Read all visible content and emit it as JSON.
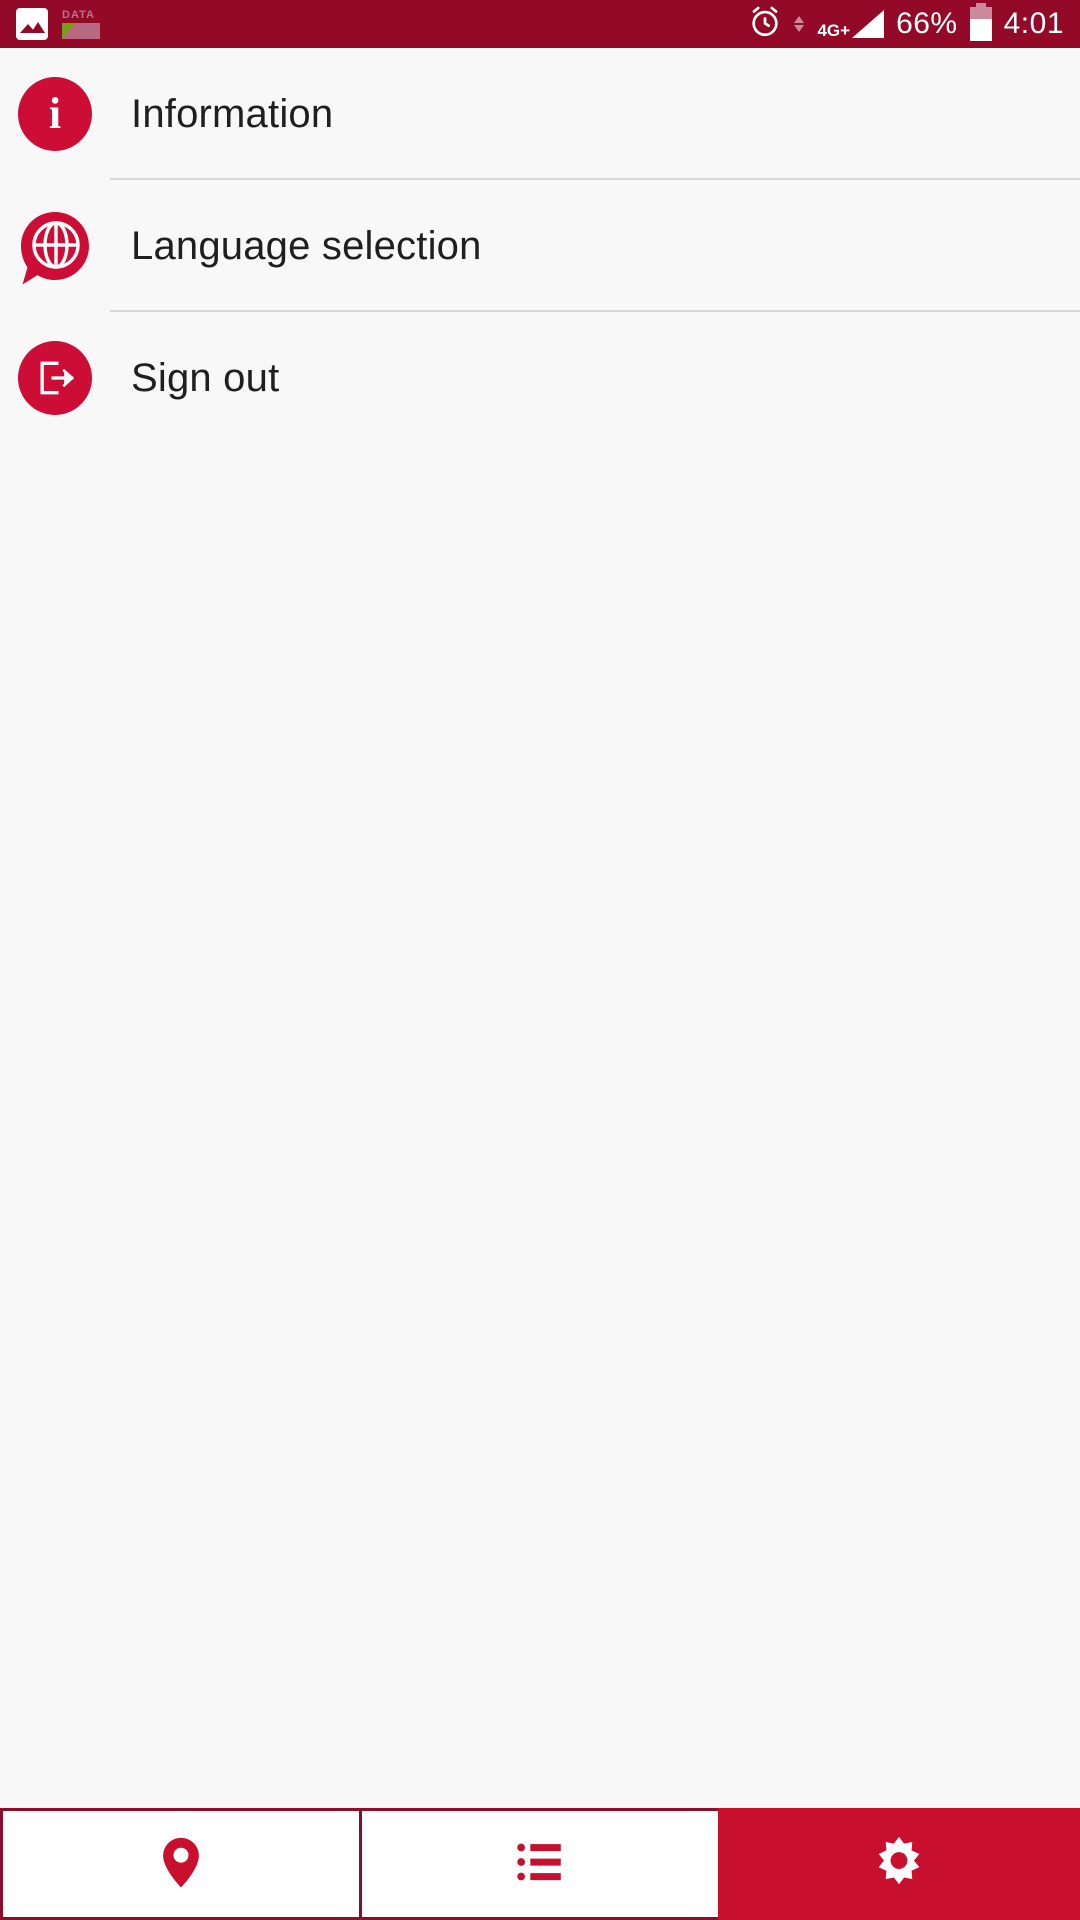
{
  "status_bar": {
    "background_color": "#930A29",
    "left_icons": [
      {
        "name": "gallery-icon",
        "label": ""
      },
      {
        "name": "data-usage-widget",
        "label": "DATA"
      }
    ],
    "alarm_icon": "alarm-clock-icon",
    "data_transfer_icon": "data-transfer-arrows-icon",
    "network_type": "4G+",
    "signal_icon": "signal-bars-icon",
    "battery_percent": "66%",
    "battery_icon": "battery-icon",
    "time": "4:01"
  },
  "theme": {
    "accent_red": "#C8102E",
    "icon_red": "#CC0D35",
    "status_red": "#930A29",
    "page_background": "#F8F8F8",
    "divider": "#D8D8D8",
    "text": "#1F1F1F"
  },
  "menu": {
    "items": [
      {
        "id": "information",
        "label": "Information",
        "icon": "info-circle-icon"
      },
      {
        "id": "language-selection",
        "label": "Language selection",
        "icon": "globe-speech-bubble-icon"
      },
      {
        "id": "sign-out",
        "label": "Sign out",
        "icon": "sign-out-icon"
      }
    ]
  },
  "bottom_nav": {
    "tabs": [
      {
        "id": "map",
        "icon": "map-pin-icon",
        "active": false
      },
      {
        "id": "list",
        "icon": "list-icon",
        "active": false
      },
      {
        "id": "settings",
        "icon": "gear-icon",
        "active": true
      }
    ]
  }
}
